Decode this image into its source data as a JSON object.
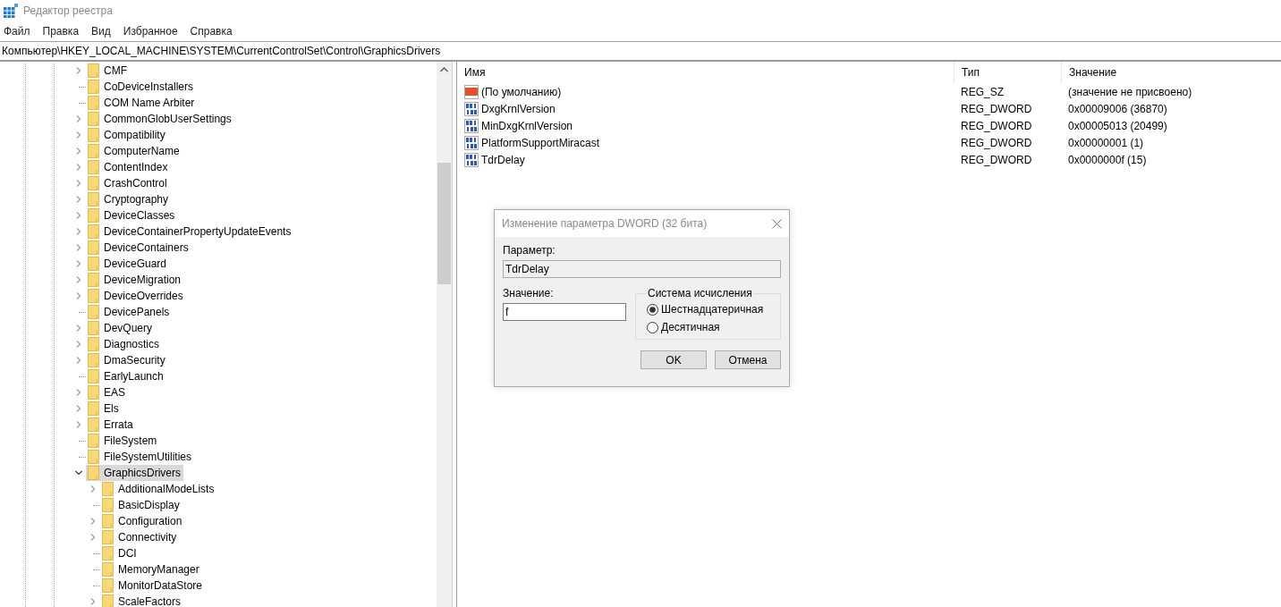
{
  "window": {
    "title": "Редактор реестра"
  },
  "menu": [
    {
      "label": "Файл"
    },
    {
      "label": "Правка"
    },
    {
      "label": "Вид"
    },
    {
      "label": "Избранное"
    },
    {
      "label": "Справка"
    }
  ],
  "address": "Компьютер\\HKEY_LOCAL_MACHINE\\SYSTEM\\CurrentControlSet\\Control\\GraphicsDrivers",
  "tree": [
    {
      "name": "CMF",
      "expandable": true,
      "selected": false
    },
    {
      "name": "CoDeviceInstallers",
      "expandable": false,
      "selected": false
    },
    {
      "name": "COM Name Arbiter",
      "expandable": false,
      "selected": false
    },
    {
      "name": "CommonGlobUserSettings",
      "expandable": true,
      "selected": false
    },
    {
      "name": "Compatibility",
      "expandable": true,
      "selected": false
    },
    {
      "name": "ComputerName",
      "expandable": true,
      "selected": false
    },
    {
      "name": "ContentIndex",
      "expandable": true,
      "selected": false
    },
    {
      "name": "CrashControl",
      "expandable": true,
      "selected": false
    },
    {
      "name": "Cryptography",
      "expandable": true,
      "selected": false
    },
    {
      "name": "DeviceClasses",
      "expandable": true,
      "selected": false
    },
    {
      "name": "DeviceContainerPropertyUpdateEvents",
      "expandable": true,
      "selected": false
    },
    {
      "name": "DeviceContainers",
      "expandable": true,
      "selected": false
    },
    {
      "name": "DeviceGuard",
      "expandable": true,
      "selected": false
    },
    {
      "name": "DeviceMigration",
      "expandable": true,
      "selected": false
    },
    {
      "name": "DeviceOverrides",
      "expandable": true,
      "selected": false
    },
    {
      "name": "DevicePanels",
      "expandable": false,
      "selected": false
    },
    {
      "name": "DevQuery",
      "expandable": true,
      "selected": false
    },
    {
      "name": "Diagnostics",
      "expandable": true,
      "selected": false
    },
    {
      "name": "DmaSecurity",
      "expandable": true,
      "selected": false
    },
    {
      "name": "EarlyLaunch",
      "expandable": false,
      "selected": false
    },
    {
      "name": "EAS",
      "expandable": true,
      "selected": false
    },
    {
      "name": "Els",
      "expandable": true,
      "selected": false
    },
    {
      "name": "Errata",
      "expandable": true,
      "selected": false
    },
    {
      "name": "FileSystem",
      "expandable": false,
      "selected": false
    },
    {
      "name": "FileSystemUtilities",
      "expandable": false,
      "selected": false
    },
    {
      "name": "GraphicsDrivers",
      "expandable": true,
      "expanded": true,
      "selected": true,
      "children": [
        {
          "name": "AdditionalModeLists",
          "expandable": true,
          "selected": false
        },
        {
          "name": "BasicDisplay",
          "expandable": false,
          "selected": false
        },
        {
          "name": "Configuration",
          "expandable": true,
          "selected": false
        },
        {
          "name": "Connectivity",
          "expandable": true,
          "selected": false
        },
        {
          "name": "DCI",
          "expandable": false,
          "selected": false
        },
        {
          "name": "MemoryManager",
          "expandable": false,
          "selected": false
        },
        {
          "name": "MonitorDataStore",
          "expandable": false,
          "selected": false
        },
        {
          "name": "ScaleFactors",
          "expandable": true,
          "selected": false
        }
      ]
    }
  ],
  "values": {
    "columns": [
      "Имя",
      "Тип",
      "Значение"
    ],
    "rows": [
      {
        "kind": "string",
        "name": "(По умолчанию)",
        "type": "REG_SZ",
        "data": "(значение не присвоено)"
      },
      {
        "kind": "dword",
        "name": "DxgKrnlVersion",
        "type": "REG_DWORD",
        "data": "0x00009006 (36870)"
      },
      {
        "kind": "dword",
        "name": "MinDxgKrnlVersion",
        "type": "REG_DWORD",
        "data": "0x00005013 (20499)"
      },
      {
        "kind": "dword",
        "name": "PlatformSupportMiracast",
        "type": "REG_DWORD",
        "data": "0x00000001 (1)"
      },
      {
        "kind": "dword",
        "name": "TdrDelay",
        "type": "REG_DWORD",
        "data": "0x0000000f (15)"
      }
    ]
  },
  "dialog": {
    "title": "Изменение параметра DWORD (32 бита)",
    "param_label": "Параметр:",
    "param_value": "TdrDelay",
    "value_label": "Значение:",
    "value": "f",
    "base_group": "Система исчисления",
    "bases": [
      {
        "label": "Шестнадцатеричная",
        "selected": true
      },
      {
        "label": "Десятичная",
        "selected": false
      }
    ],
    "buttons": [
      "OK",
      "Отмена"
    ]
  }
}
